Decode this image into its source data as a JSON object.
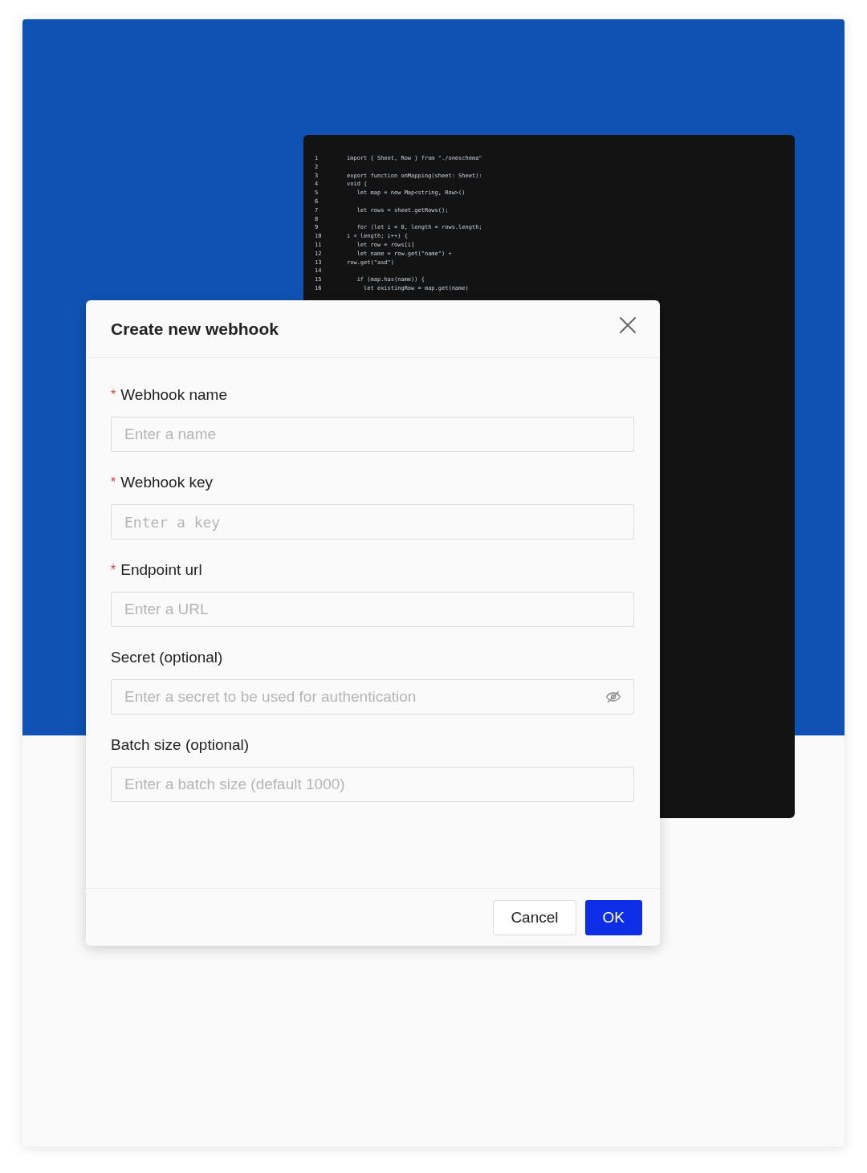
{
  "code_panel": {
    "lines": [
      {
        "number": "1",
        "text": "import { Sheet, Row } from \"./oneschema\""
      },
      {
        "number": "2"
      },
      {
        "number": "3",
        "text": "export function onMapping(sheet: Sheet):"
      },
      {
        "number": "4",
        "text": "void {"
      },
      {
        "number": "5",
        "text": "   let map = new Map<string, Row>()"
      },
      {
        "number": "6"
      },
      {
        "number": "7",
        "text": "   let rows = sheet.getRows();"
      },
      {
        "number": "8"
      },
      {
        "number": "9",
        "text": "   for (let i = 0, length = rows.length;"
      },
      {
        "number": "10",
        "text": "i < length; i++) {"
      },
      {
        "number": "11",
        "text": "   let row = rows[i]"
      },
      {
        "number": "12",
        "text": "   let name = row.get(\"name\") +"
      },
      {
        "number": "13",
        "text": "row.get(\"asd\")"
      },
      {
        "number": "14"
      },
      {
        "number": "15",
        "text": "   if (map.has(name)) {"
      },
      {
        "number": "16",
        "text": "     let existingRow = map.get(name)"
      }
    ]
  },
  "dialog": {
    "title": "Create new webhook",
    "fields": [
      {
        "required_mark": "*",
        "label": "Webhook name",
        "placeholder": "Enter a name",
        "kind": "text"
      },
      {
        "required_mark": "*",
        "label": "Webhook key",
        "placeholder": "Enter a key",
        "kind": "mono"
      },
      {
        "required_mark": "*",
        "label": "Endpoint url",
        "placeholder": "Enter a URL",
        "kind": "text"
      },
      {
        "label": "Secret (optional)",
        "placeholder": "Enter a secret to be used for authentication",
        "kind": "secret"
      },
      {
        "label": "Batch size (optional)",
        "placeholder": "Enter a batch size (default 1000)",
        "kind": "text"
      }
    ],
    "buttons": [
      {
        "label": "Cancel",
        "kind": "secondary"
      },
      {
        "label": "OK",
        "kind": "primary"
      }
    ]
  }
}
